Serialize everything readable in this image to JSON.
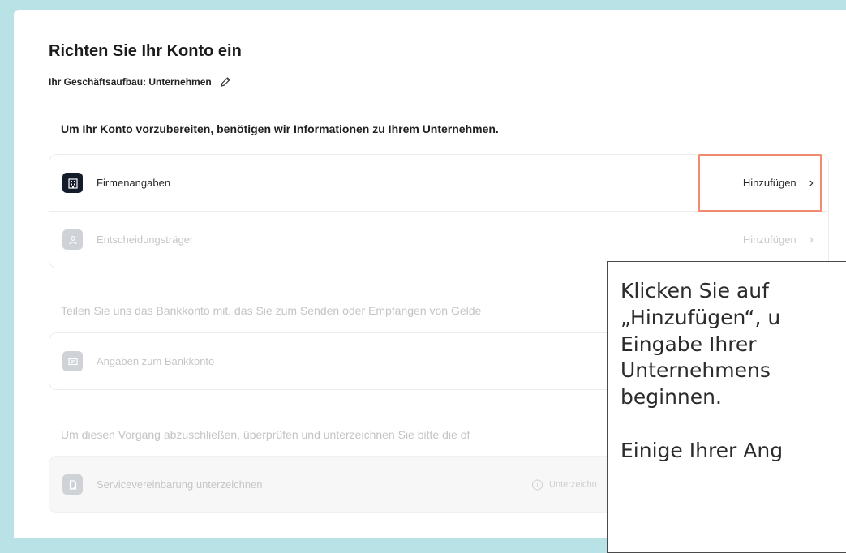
{
  "header": {
    "title": "Richten Sie Ihr Konto ein",
    "subtitle": "Ihr Geschäftsaufbau: Unternehmen"
  },
  "sections": [
    {
      "description": "Um Ihr Konto vorzubereiten, benötigen wir Informationen zu Ihrem Unternehmen.",
      "rows": [
        {
          "label": "Firmenangaben",
          "action": "Hinzufügen",
          "icon": "building-icon"
        },
        {
          "label": "Entscheidungsträger",
          "action": "Hinzufügen",
          "icon": "person-icon"
        }
      ]
    },
    {
      "description": "Teilen Sie uns das Bankkonto mit, das Sie zum Senden oder Empfangen von Gelde",
      "rows": [
        {
          "label": "Angaben zum Bankkonto",
          "icon": "bank-card-icon"
        }
      ]
    },
    {
      "description": "Um diesen Vorgang abzuschließen, überprüfen und unterzeichnen Sie bitte die of",
      "rows": [
        {
          "label": "Servicevereinbarung unterzeichnen",
          "note": "Unterzeichn",
          "icon": "document-icon"
        }
      ]
    }
  ],
  "tooltip": {
    "paragraph1": [
      "Klicken Sie auf",
      "„Hinzufügen“, u",
      "Eingabe Ihrer",
      "Unternehmens",
      "beginnen."
    ],
    "paragraph2": [
      "Einige Ihrer Ang"
    ]
  },
  "colors": {
    "background": "#b9e2e7",
    "highlight": "#f08b72",
    "icon_dark": "#141c2b",
    "icon_muted": "#cfd3d8"
  }
}
